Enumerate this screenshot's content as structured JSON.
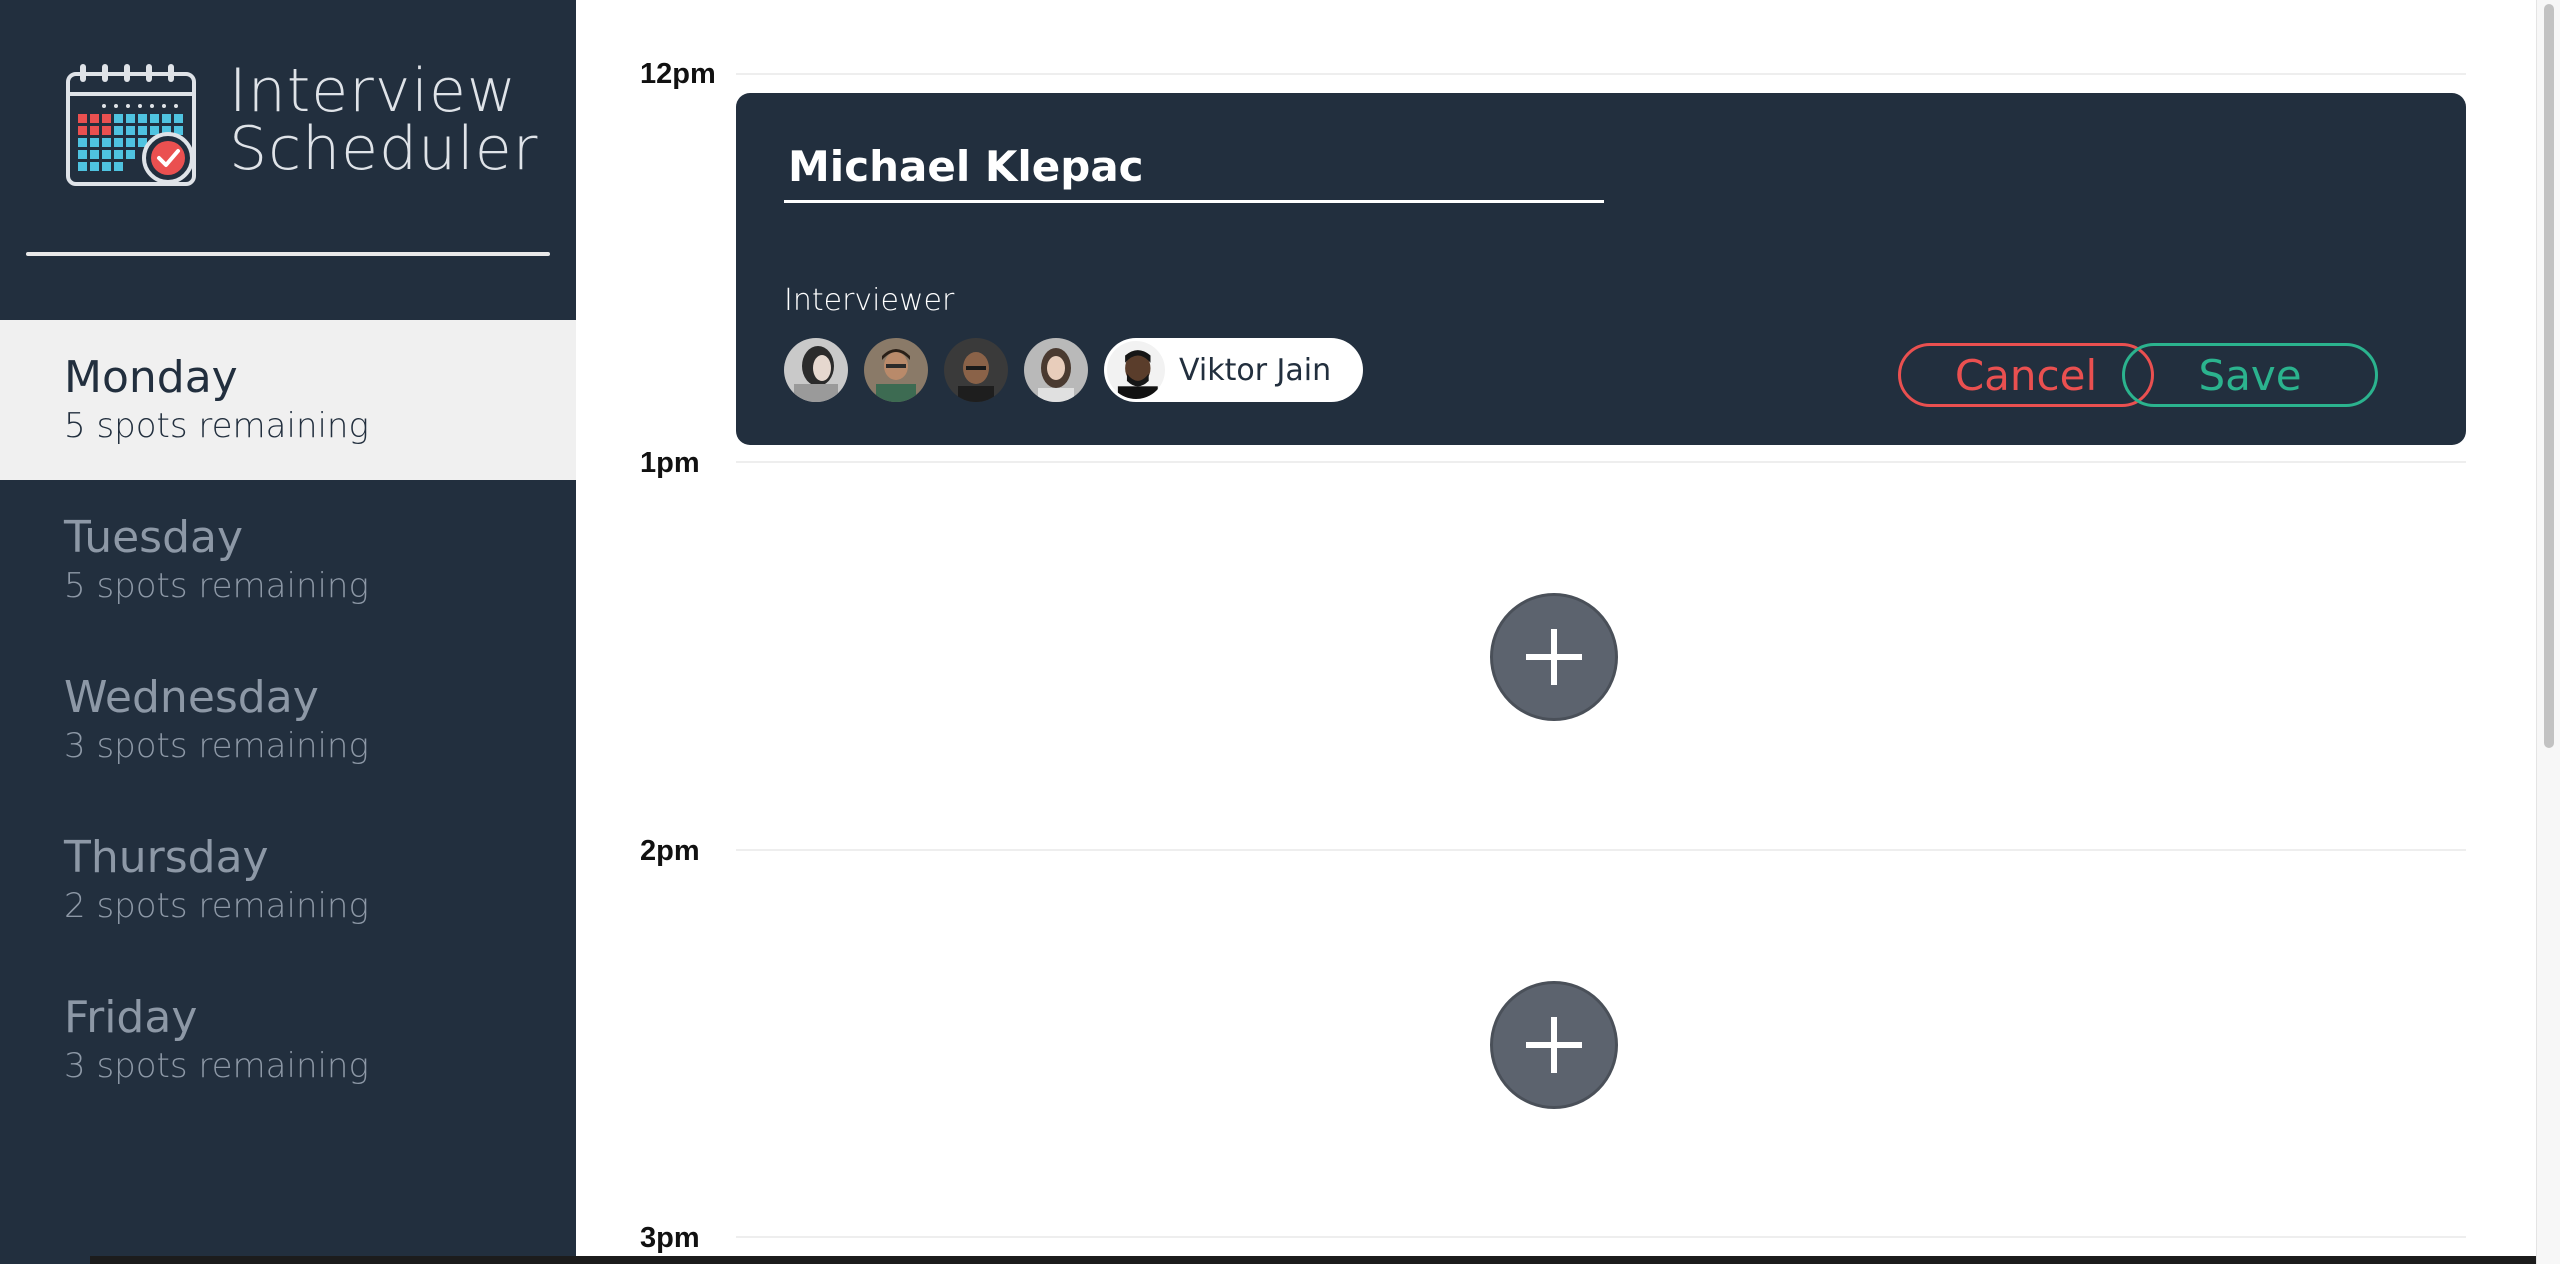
{
  "app": {
    "brand_line1": "Interview",
    "brand_line2": "Scheduler",
    "logo_icon": "calendar-check-icon"
  },
  "sidebar": {
    "days": [
      {
        "name": "Monday",
        "spots": "5 spots remaining",
        "selected": true
      },
      {
        "name": "Tuesday",
        "spots": "5 spots remaining",
        "selected": false
      },
      {
        "name": "Wednesday",
        "spots": "3 spots remaining",
        "selected": false
      },
      {
        "name": "Thursday",
        "spots": "2 spots remaining",
        "selected": false
      },
      {
        "name": "Friday",
        "spots": "3 spots remaining",
        "selected": false
      }
    ]
  },
  "schedule": {
    "times": [
      "12pm",
      "1pm",
      "2pm",
      "3pm"
    ],
    "form": {
      "student_name": "Michael Klepac",
      "interviewer_label": "Interviewer",
      "selected_interviewer": "Viktor Jain",
      "cancel_label": "Cancel",
      "save_label": "Save"
    },
    "add_icon": "plus-icon"
  },
  "colors": {
    "sidebar_bg": "#222f3e",
    "selected_day_bg": "#f0f0f0",
    "cancel": "#ea5050",
    "save": "#2bb38e",
    "add_button": "#5c636e"
  }
}
